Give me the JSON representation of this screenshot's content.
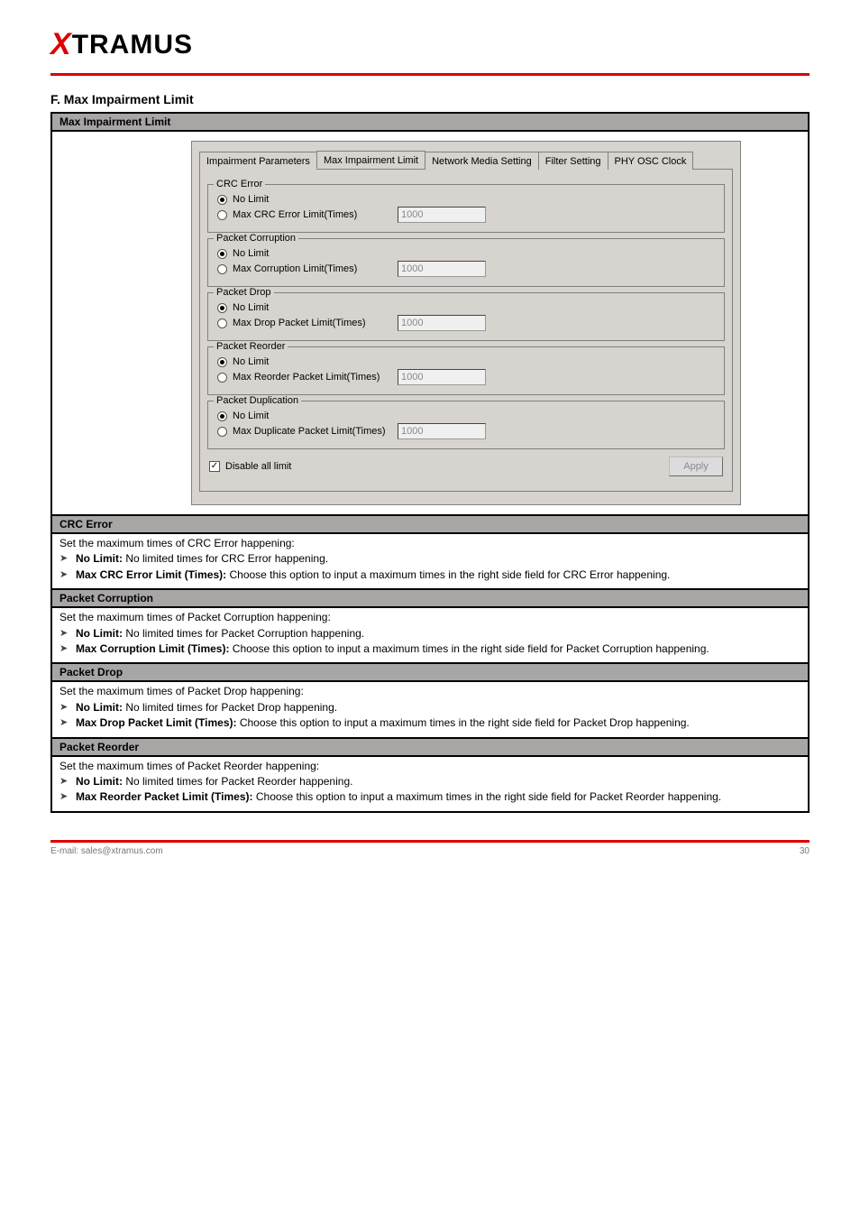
{
  "brand": {
    "x": "X",
    "rest": "TRAMUS"
  },
  "section_title": "F. Max Impairment Limit",
  "footer": {
    "left": "E-mail: sales@xtramus.com",
    "right": "30"
  },
  "dlg": {
    "tabs": [
      "Impairment Parameters",
      "Max Impairment Limit",
      "Network Media Setting",
      "Filter Setting",
      "PHY OSC Clock"
    ],
    "active_tab": 1,
    "groups": [
      {
        "legend": "CRC Error",
        "nolimit": "No Limit",
        "maxlabel": "Max CRC Error Limit(Times)",
        "value": "1000"
      },
      {
        "legend": "Packet Corruption",
        "nolimit": "No Limit",
        "maxlabel": "Max Corruption Limit(Times)",
        "value": "1000"
      },
      {
        "legend": "Packet Drop",
        "nolimit": "No Limit",
        "maxlabel": "Max Drop Packet Limit(Times)",
        "value": "1000"
      },
      {
        "legend": "Packet Reorder",
        "nolimit": "No Limit",
        "maxlabel": "Max Reorder Packet  Limit(Times)",
        "value": "1000"
      },
      {
        "legend": "Packet Duplication",
        "nolimit": "No Limit",
        "maxlabel": "Max Duplicate Packet Limit(Times)",
        "value": "1000"
      }
    ],
    "disable_all": "Disable all limit",
    "apply": "Apply"
  },
  "rows": [
    {
      "header": "Max Impairment Limit",
      "screenshot": true
    },
    {
      "header": "CRC Error",
      "intro": "Set the maximum times of CRC Error happening:",
      "bullets": [
        {
          "b": "No Limit:",
          "t": " No limited times for CRC Error happening."
        },
        {
          "b": "Max CRC Error Limit (Times):",
          "t": " Choose this option to input a maximum times in the right side field for CRC Error happening."
        }
      ]
    },
    {
      "header": "Packet Corruption",
      "intro": "Set the maximum times of Packet Corruption happening:",
      "bullets": [
        {
          "b": "No Limit:",
          "t": " No limited times for Packet Corruption happening."
        },
        {
          "b": "Max Corruption Limit (Times):",
          "t": " Choose this option to input a maximum times in the right side field for Packet Corruption happening."
        }
      ]
    },
    {
      "header": "Packet Drop",
      "intro": "Set the maximum times of Packet Drop happening:",
      "bullets": [
        {
          "b": "No Limit:",
          "t": " No limited times for Packet Drop happening."
        },
        {
          "b": "Max Drop Packet Limit (Times):",
          "t": " Choose this option to input a maximum times in the right side field for Packet Drop happening."
        }
      ]
    },
    {
      "header": "Packet Reorder",
      "intro": "Set the maximum times of Packet Reorder happening:",
      "bullets": [
        {
          "b": "No Limit:",
          "t": " No limited times for Packet Reorder happening."
        },
        {
          "b": "Max Reorder Packet Limit (Times):",
          "t": " Choose this option to input a maximum times in the right side field for Packet Reorder happening."
        }
      ]
    }
  ]
}
